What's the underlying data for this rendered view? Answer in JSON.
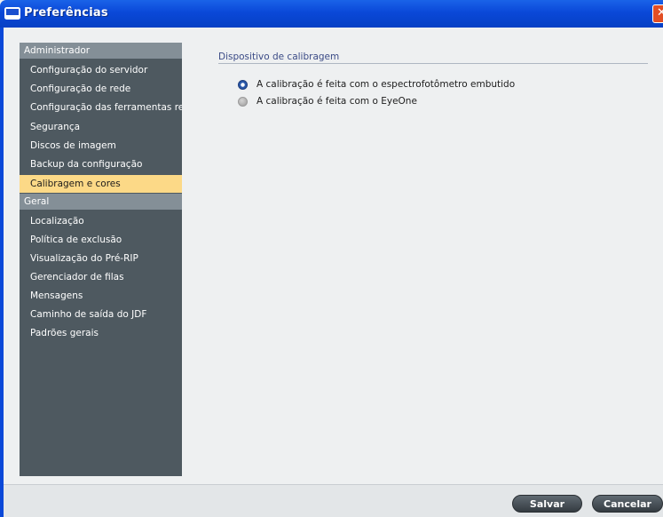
{
  "window": {
    "title": "Preferências",
    "close_label": "✕"
  },
  "sidebar": {
    "groups": [
      {
        "header": "Administrador",
        "items": [
          {
            "label": "Configuração do servidor",
            "selected": false
          },
          {
            "label": "Configuração de rede",
            "selected": false
          },
          {
            "label": "Configuração das ferramentas re...",
            "selected": false
          },
          {
            "label": "Segurança",
            "selected": false
          },
          {
            "label": "Discos de imagem",
            "selected": false
          },
          {
            "label": "Backup da configuração",
            "selected": false
          },
          {
            "label": "Calibragem e cores",
            "selected": true
          }
        ]
      },
      {
        "header": "Geral",
        "items": [
          {
            "label": "Localização",
            "selected": false
          },
          {
            "label": "Política de exclusão",
            "selected": false
          },
          {
            "label": "Visualização do Pré-RIP",
            "selected": false
          },
          {
            "label": "Gerenciador de filas",
            "selected": false
          },
          {
            "label": "Mensagens",
            "selected": false
          },
          {
            "label": "Caminho de saída do JDF",
            "selected": false
          },
          {
            "label": "Padrões gerais",
            "selected": false
          }
        ]
      }
    ]
  },
  "main": {
    "section_title": "Dispositivo de calibragem",
    "options": [
      {
        "label": "A calibração é feita com o espectrofotômetro embutido",
        "selected": true
      },
      {
        "label": "A calibração é feita com o EyeOne",
        "selected": false
      }
    ]
  },
  "footer": {
    "save_label": "Salvar",
    "cancel_label": "Cancelar"
  },
  "colors": {
    "sidebar_bg": "#4e5960",
    "group_header_bg": "#848f97",
    "selected_item_bg": "#fcd987",
    "titlebar": "#0a48d8"
  }
}
